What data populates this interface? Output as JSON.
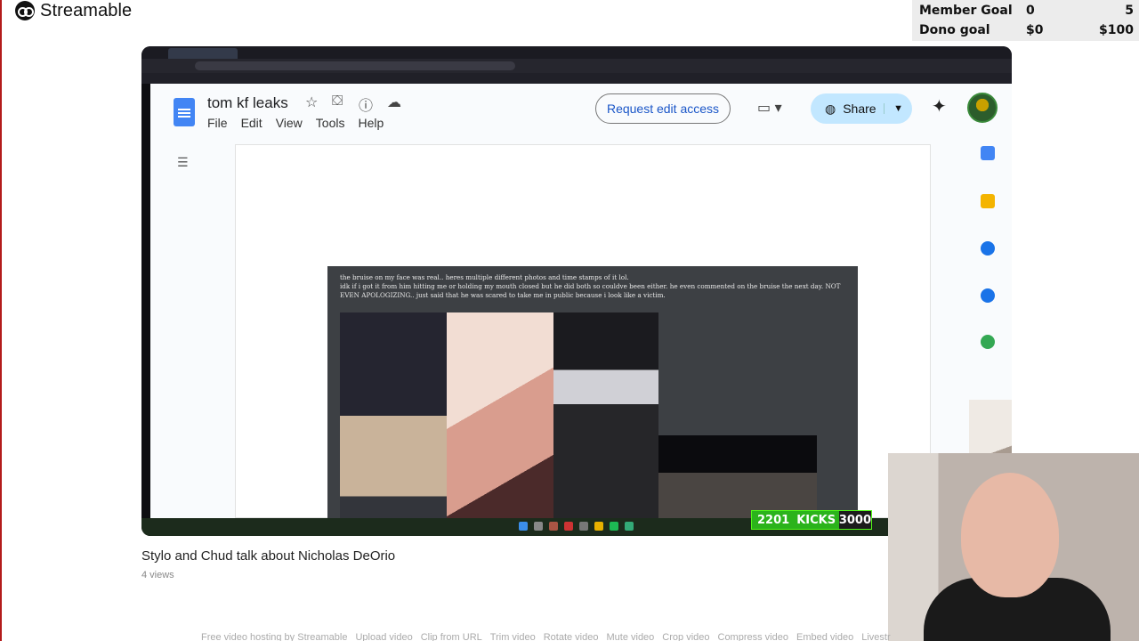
{
  "brand": {
    "name": "Streamable",
    "logo_icon": "streamable-logo-icon"
  },
  "goals": [
    {
      "name": "Member Goal",
      "current": "0",
      "target": "5"
    },
    {
      "name": "Dono goal",
      "current": "$0",
      "target": "$100"
    }
  ],
  "doc": {
    "title": "tom kf leaks",
    "menu": [
      "File",
      "Edit",
      "View",
      "Tools",
      "Help"
    ],
    "request_label": "Request edit access",
    "share_label": "Share",
    "embed_text_line1": "the bruise on my face was real.. heres multiple different photos and time stamps of it lol.",
    "embed_text_line2": "idk if i got it from him hitting me or holding my mouth closed but he did both so couldve been either. he even commented on the bruise the next day. NOT EVEN APOLOGIZING.. just said that he was scared to take me in public because i look like a victim."
  },
  "overlay": {
    "kicks_current": "2201",
    "kicks_label": "KICKS",
    "kicks_goal": "3000",
    "kicks_fraction": 0.734
  },
  "video": {
    "title": "Stylo and Chud talk about Nicholas DeOrio",
    "views": "4 views"
  },
  "footer_links": [
    "Free video hosting by Streamable",
    "Upload video",
    "Clip from URL",
    "Trim video",
    "Rotate video",
    "Mute video",
    "Crop video",
    "Compress video",
    "Embed video",
    "Livestr"
  ],
  "colors": {
    "kick_green": "#53fc18",
    "share_blue": "#c2e7ff",
    "docs_blue": "#4285f4"
  }
}
